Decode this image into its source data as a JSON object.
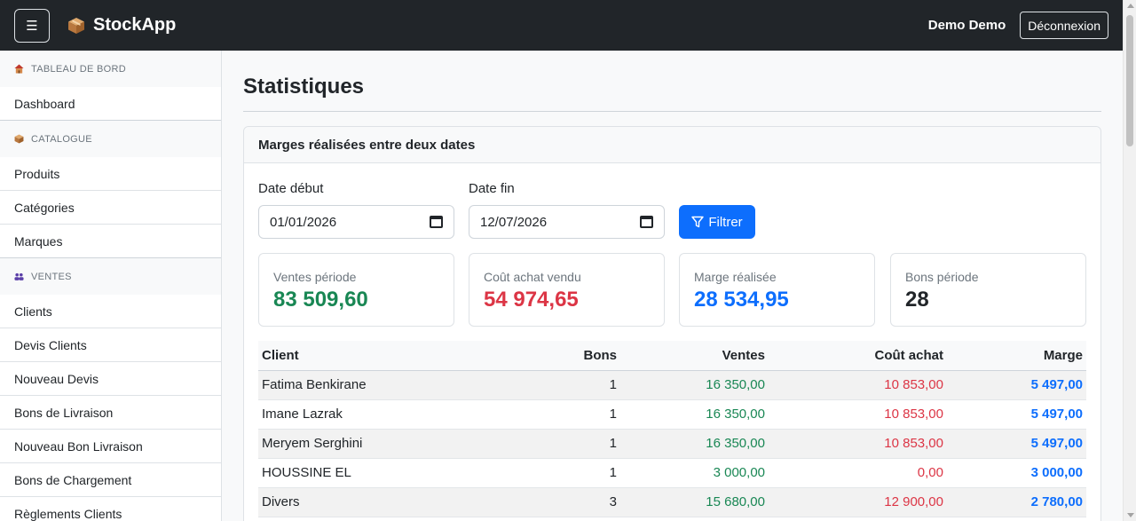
{
  "navbar": {
    "menu_icon": "hamburger-icon",
    "brand_icon": "package-icon",
    "brand": "StockApp",
    "user": "Demo Demo",
    "logout": "Déconnexion"
  },
  "sidebar": {
    "sections": [
      {
        "label": "TABLEAU DE BORD",
        "icon": "house-icon",
        "items": [
          "Dashboard"
        ]
      },
      {
        "label": "CATALOGUE",
        "icon": "package-icon",
        "items": [
          "Produits",
          "Catégories",
          "Marques"
        ]
      },
      {
        "label": "VENTES",
        "icon": "users-icon",
        "items": [
          "Clients",
          "Devis Clients",
          "Nouveau Devis",
          "Bons de Livraison",
          "Nouveau Bon Livraison",
          "Bons de Chargement",
          "Règlements Clients"
        ]
      }
    ]
  },
  "main": {
    "title": "Statistiques",
    "card_title": "Marges réalisées entre deux dates",
    "date_start_label": "Date début",
    "date_start_value": "01/01/2026",
    "date_end_label": "Date fin",
    "date_end_value": "12/07/2026",
    "filter_label": "Filtrer",
    "filter_icon": "funnel-icon",
    "calendar_icon": "calendar-icon",
    "stats": [
      {
        "label": "Ventes période",
        "value": "83 509,60",
        "color": "#198754"
      },
      {
        "label": "Coût achat vendu",
        "value": "54 974,65",
        "color": "#dc3545"
      },
      {
        "label": "Marge réalisée",
        "value": "28 534,95",
        "color": "#0d6efd"
      },
      {
        "label": "Bons période",
        "value": "28",
        "color": "#212529"
      }
    ],
    "table": {
      "headers": [
        "Client",
        "Bons",
        "Ventes",
        "Coût achat",
        "Marge"
      ],
      "rows": [
        [
          "Fatima Benkirane",
          "1",
          "16 350,00",
          "10 853,00",
          "5 497,00"
        ],
        [
          "Imane Lazrak",
          "1",
          "16 350,00",
          "10 853,00",
          "5 497,00"
        ],
        [
          "Meryem Serghini",
          "1",
          "16 350,00",
          "10 853,00",
          "5 497,00"
        ],
        [
          "HOUSSINE EL",
          "1",
          "3 000,00",
          "0,00",
          "3 000,00"
        ],
        [
          "Divers",
          "3",
          "15 680,00",
          "12 900,00",
          "2 780,00"
        ]
      ]
    }
  }
}
